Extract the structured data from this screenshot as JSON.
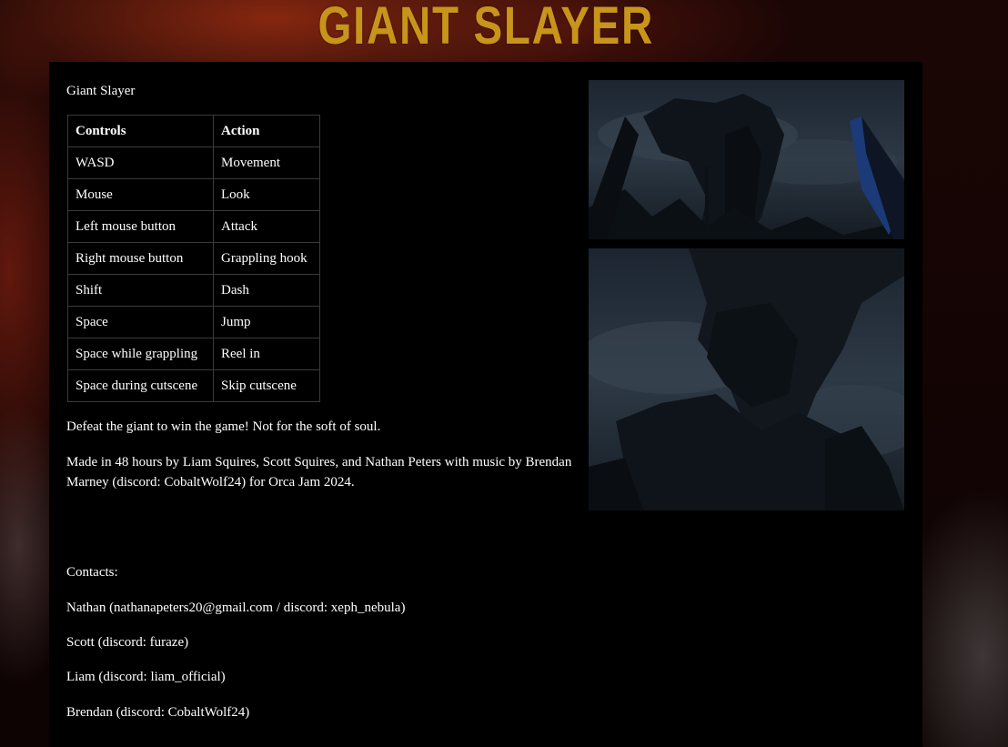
{
  "header": {
    "logo_text": "GIANT SLAYER"
  },
  "main": {
    "title": "Giant Slayer",
    "controls_table": {
      "headers": [
        "Controls",
        "Action"
      ],
      "rows": [
        [
          "WASD",
          "Movement"
        ],
        [
          "Mouse",
          "Look"
        ],
        [
          "Left mouse button",
          "Attack"
        ],
        [
          "Right mouse button",
          "Grappling hook"
        ],
        [
          "Shift",
          "Dash"
        ],
        [
          "Space",
          "Jump"
        ],
        [
          "Space while grappling",
          "Reel in"
        ],
        [
          "Space during cutscene",
          "Skip cutscene"
        ]
      ]
    },
    "description": "Defeat the giant to win the game! Not for the soft of soul.",
    "credits": "Made in 48 hours by Liam Squires, Scott Squires, and Nathan Peters with music by Brendan Marney (discord: CobaltWolf24) for Orca Jam 2024.",
    "contacts_heading": "Contacts:",
    "contacts": [
      "Nathan (nathanapeters20@gmail.com / discord: xeph_nebula)",
      "Scott (discord: furaze)",
      "Liam (discord: liam_official)",
      "Brendan (discord: CobaltWolf24)"
    ]
  },
  "screenshots": [
    {
      "alt": "screenshot-1"
    },
    {
      "alt": "screenshot-2"
    }
  ],
  "colors": {
    "logo": "#c8951a",
    "content_bg": "#000000",
    "text": "#ffffff",
    "table_border": "#3a3a3a"
  }
}
